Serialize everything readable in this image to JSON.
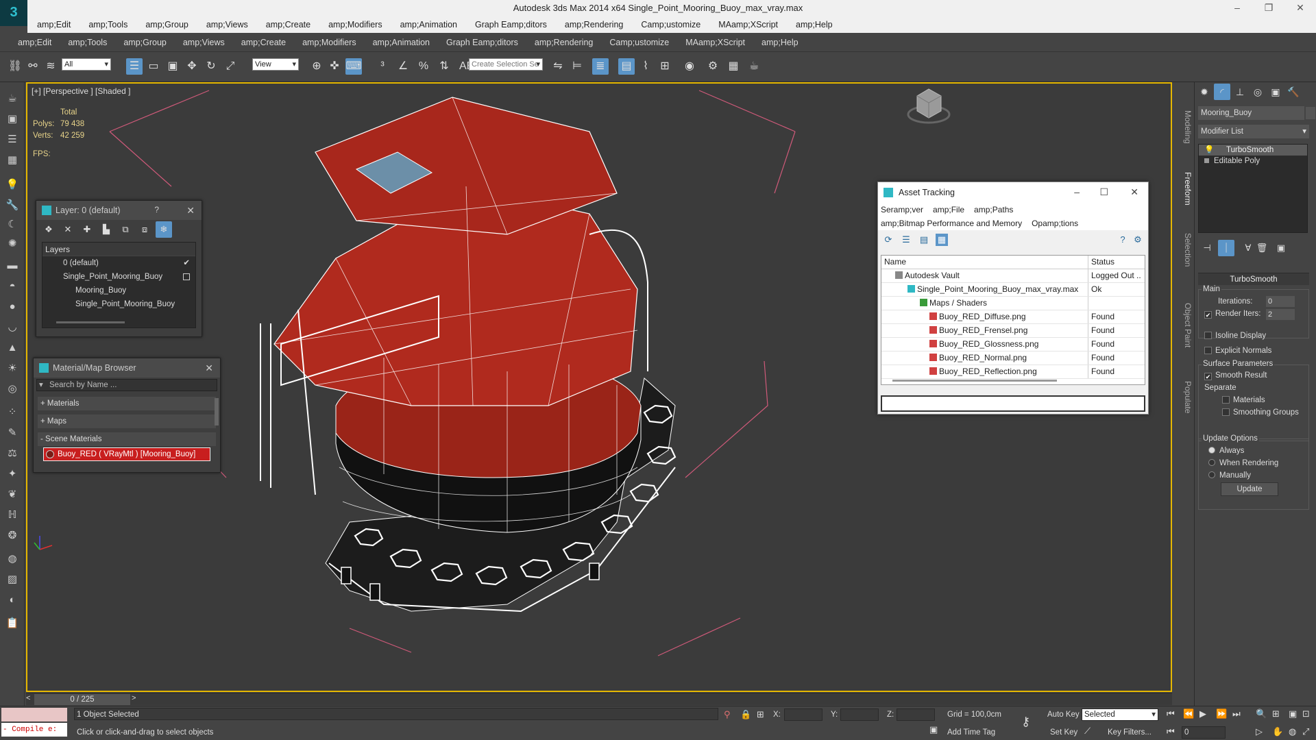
{
  "app": {
    "logo": "3",
    "title": "Autodesk 3ds Max  2014 x64     Single_Point_Mooring_Buoy_max_vray.max"
  },
  "menu_top": [
    "amp;Edit",
    "amp;Tools",
    "amp;Group",
    "amp;Views",
    "amp;Create",
    "amp;Modifiers",
    "amp;Animation",
    "Graph Eamp;ditors",
    "amp;Rendering",
    "Camp;ustomize",
    "MAamp;XScript",
    "amp;Help"
  ],
  "menu_main": [
    "amp;Edit",
    "amp;Tools",
    "amp;Group",
    "amp;Views",
    "amp;Create",
    "amp;Modifiers",
    "amp;Animation",
    "Graph Eamp;ditors",
    "amp;Rendering",
    "Camp;ustomize",
    "MAamp;XScript",
    "amp;Help"
  ],
  "toolbar": {
    "filter_value": "All",
    "refcoord_value": "View",
    "selection_set_placeholder": "Create Selection Se"
  },
  "viewport": {
    "label": "[+] [Perspective ] [Shaded ]",
    "stats": {
      "header": "Total",
      "polys_label": "Polys:",
      "polys_value": "79 438",
      "verts_label": "Verts:",
      "verts_value": "42 259",
      "fps_label": "FPS:"
    }
  },
  "layer_panel": {
    "title": "Layer: 0 (default)",
    "help": "?",
    "column_header": "Layers",
    "items": [
      "0 (default)",
      "Single_Point_Mooring_Buoy",
      "Mooring_Buoy",
      "Single_Point_Mooring_Buoy"
    ]
  },
  "material_browser": {
    "title": "Material/Map Browser",
    "search_placeholder": "Search by Name ...",
    "sections": [
      "+ Materials",
      "+ Maps",
      "- Scene Materials"
    ],
    "scene_material": "Buoy_RED  ( VRayMtl )  [Mooring_Buoy]"
  },
  "asset_tracking": {
    "title": "Asset Tracking",
    "menu1": [
      "Seramp;ver",
      "amp;File",
      "amp;Paths"
    ],
    "menu2": [
      "amp;Bitmap Performance and Memory",
      "Opamp;tions"
    ],
    "col_name": "Name",
    "col_status": "Status",
    "rows": [
      {
        "name": "Autodesk Vault",
        "status": "Logged Out ..."
      },
      {
        "name": "Single_Point_Mooring_Buoy_max_vray.max",
        "status": "Ok"
      },
      {
        "name": "Maps / Shaders",
        "status": ""
      },
      {
        "name": "Buoy_RED_Diffuse.png",
        "status": "Found"
      },
      {
        "name": "Buoy_RED_Frensel.png",
        "status": "Found"
      },
      {
        "name": "Buoy_RED_Glossness.png",
        "status": "Found"
      },
      {
        "name": "Buoy_RED_Normal.png",
        "status": "Found"
      },
      {
        "name": "Buoy_RED_Reflection.png",
        "status": "Found"
      }
    ]
  },
  "side_tabs": [
    "Modeling",
    "Freeform",
    "Selection",
    "Object Paint",
    "Populate"
  ],
  "command_panel": {
    "object_name": "Mooring_Buoy",
    "modifier_list": "Modifier List",
    "stack": [
      "TurboSmooth",
      "Editable Poly"
    ],
    "rollout_title": "TurboSmooth",
    "main_label": "Main",
    "iterations_label": "Iterations:",
    "iterations_value": "0",
    "render_iters_label": "Render Iters:",
    "render_iters_value": "2",
    "isoline_label": "Isoline Display",
    "explicit_label": "Explicit Normals",
    "surface_label": "Surface Parameters",
    "smooth_result_label": "Smooth Result",
    "separate_label": "Separate",
    "materials_label": "Materials",
    "smoothing_groups_label": "Smoothing Groups",
    "update_options_label": "Update Options",
    "always_label": "Always",
    "when_rendering_label": "When Rendering",
    "manually_label": "Manually",
    "update_button": "Update"
  },
  "timeline": {
    "frame": "0 / 225"
  },
  "statusbar": {
    "compile_text": "- Compile e:",
    "selected_text": "1 Object Selected",
    "prompt_text": "Click or click-and-drag to select objects",
    "x_label": "X:",
    "y_label": "Y:",
    "z_label": "Z:",
    "grid": "Grid = 100,0cm",
    "add_time_tag": "Add Time Tag",
    "auto_key": "Auto Key",
    "set_key": "Set Key",
    "selected_dropdown": "Selected",
    "key_filters": "Key Filters...",
    "frame_value": "0"
  },
  "colors": {
    "viewport_border": "#e6b800",
    "buoy_red": "#b02a1e",
    "accent": "#5b95c8",
    "selected_material": "#c81e1e"
  }
}
